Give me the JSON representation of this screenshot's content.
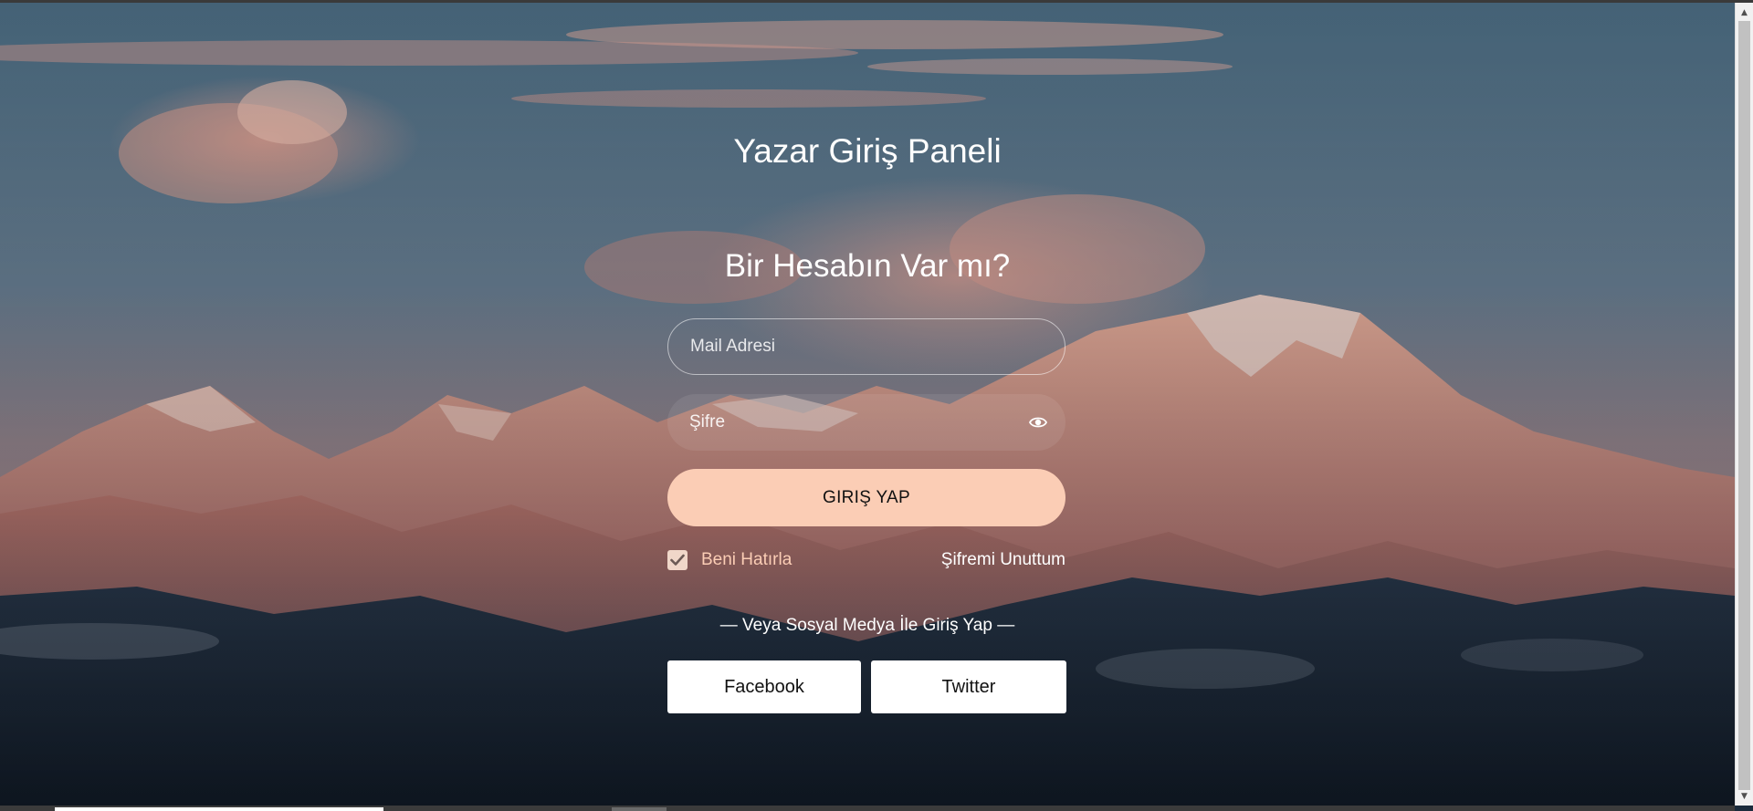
{
  "header": {
    "title": "Yazar Giriş Paneli",
    "subtitle": "Bir Hesabın Var mı?"
  },
  "form": {
    "email": {
      "placeholder": "Mail Adresi",
      "value": ""
    },
    "password": {
      "placeholder": "Şifre",
      "value": "",
      "toggle_icon": "eye-icon"
    },
    "submit_label": "GIRIŞ YAP",
    "remember_me": {
      "label": "Beni Hatırla",
      "checked": true
    },
    "forgot_password_label": "Şifremi Unuttum"
  },
  "social": {
    "divider_text": "— Veya Sosyal Medya İle Giriş Yap —",
    "buttons": [
      {
        "label": "Facebook"
      },
      {
        "label": "Twitter"
      }
    ]
  },
  "colors": {
    "accent": "#fbcdb5",
    "button_bg": "#fbcdb5",
    "text": "#ffffff",
    "social_bg": "#ffffff"
  }
}
